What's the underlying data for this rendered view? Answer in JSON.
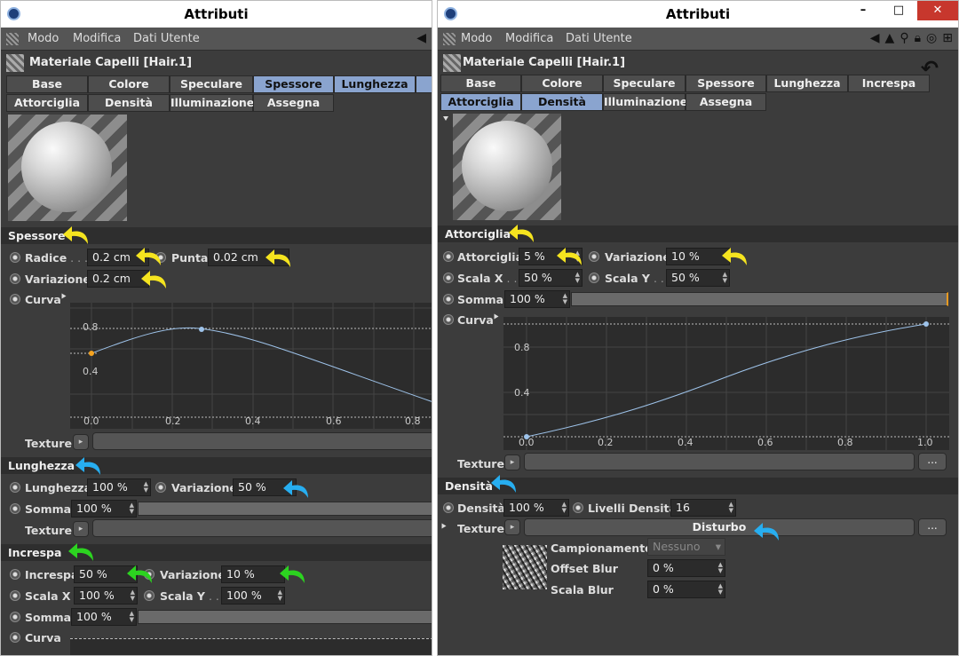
{
  "colors": {
    "yellow": "#f5e41f",
    "blue": "#27aef0",
    "green": "#2cd320",
    "tab_selected": "#8aa4cf",
    "curve": "#9ec3ea",
    "panel": "#3c3c3c"
  },
  "left": {
    "title": "Attributi",
    "menu": [
      "Modo",
      "Modifica",
      "Dati Utente"
    ],
    "object": "Materiale Capelli [Hair.1]",
    "tabs_row1": [
      "Base",
      "Colore",
      "Speculare",
      "Spessore",
      "Lunghezza"
    ],
    "tabs_row2": [
      "Attorciglia",
      "Densità",
      "Illuminazione",
      "Assegna"
    ],
    "selected_tabs": [
      "Spessore",
      "Lunghezza"
    ],
    "spessore": {
      "title": "Spessore",
      "radice_label": "Radice",
      "radice_dots": " . . .",
      "radice_value": "0.2 cm",
      "punta_label": "Punta",
      "punta_value": "0.02 cm",
      "variazione_label": "Variazione",
      "variazione_value": "0.2 cm",
      "curva_label": "Curva",
      "texture_label": "Texture"
    },
    "graph1": {
      "y_ticks": [
        "0.8",
        "0.4"
      ],
      "x_ticks": [
        "0.0",
        "0.2",
        "0.4",
        "0.6",
        "0.8"
      ]
    },
    "lunghezza": {
      "title": "Lunghezza",
      "lunghezza_label": "Lunghezza",
      "lunghezza_value": "100 %",
      "variazione_label": "Variazione",
      "variazione_value": "50 %",
      "somma_label": "Somma",
      "somma_value": "100 %",
      "texture_label": "Texture"
    },
    "increspa": {
      "title": "Increspa",
      "increspa_label": "Increspa",
      "increspa_value": "50 %",
      "variazione_label": "Variazione",
      "variazione_value": "10 %",
      "scalax_label": "Scala X",
      "scalax_value": "100 %",
      "scalay_label": "Scala Y",
      "scalay_dots": " . . .",
      "scalay_value": "100 %",
      "somma_label": "Somma",
      "somma_value": "100 %",
      "curva_label": "Curva"
    }
  },
  "right": {
    "title": "Attributi",
    "window_buttons": [
      "–",
      "□",
      "✕"
    ],
    "menu": [
      "Modo",
      "Modifica",
      "Dati Utente"
    ],
    "object": "Materiale Capelli [Hair.1]",
    "tabs_row1": [
      "Base",
      "Colore",
      "Speculare",
      "Spessore",
      "Lunghezza",
      "Increspa"
    ],
    "tabs_row2": [
      "Attorciglia",
      "Densità",
      "Illuminazione",
      "Assegna"
    ],
    "selected_tabs": [
      "Attorciglia",
      "Densità"
    ],
    "attorciglia": {
      "title": "Attorciglia",
      "attorciglia_label": "Attorciglia",
      "attorciglia_value": "5 %",
      "variazione_label": "Variazione",
      "variazione_value": "10 %",
      "scalax_label": "Scala X",
      "scalax_dots": " . . .",
      "scalax_value": "50 %",
      "scalay_label": "Scala Y",
      "scalay_dots": " . . .",
      "scalay_value": "50 %",
      "somma_label": "Somma",
      "somma_value": "100 %",
      "curva_label": "Curva",
      "texture_label": "Texture",
      "ellipsis": "..."
    },
    "graph2": {
      "y_ticks": [
        "0.8",
        "0.4"
      ],
      "x_ticks": [
        "0.0",
        "0.2",
        "0.4",
        "0.6",
        "0.8",
        "1.0"
      ]
    },
    "densita": {
      "title": "Densità",
      "densita_label": "Densità",
      "densita_value": "100 %",
      "livelli_label": "Livelli Densità",
      "livelli_value": "16",
      "texture_label": "Texture",
      "texture_value": "Disturbo",
      "ellipsis": "...",
      "campionamento_label": "Campionamento",
      "campionamento_value": "Nessuno",
      "offset_label": "Offset Blur",
      "offset_value": "0 %",
      "scala_label": "Scala Blur",
      "scala_value": "0 %"
    }
  }
}
